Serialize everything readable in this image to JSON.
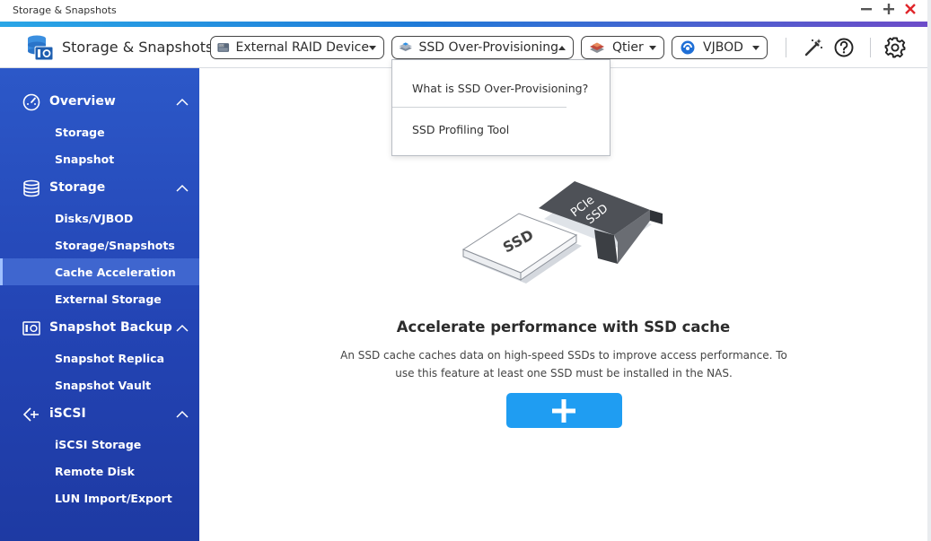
{
  "window": {
    "title": "Storage & Snapshots"
  },
  "toolbar": {
    "app_name": "Storage & Snapshots",
    "buttons": [
      {
        "label": "External RAID Device",
        "icon": "raid-device-icon"
      },
      {
        "label": "SSD Over-Provisioning",
        "icon": "ssd-stack-icon"
      },
      {
        "label": "Qtier",
        "icon": "qtier-icon"
      },
      {
        "label": "VJBOD",
        "icon": "vjbod-icon"
      }
    ],
    "icons": [
      "magic-wand-icon",
      "help-icon",
      "gear-icon"
    ]
  },
  "dropdown": {
    "items": [
      {
        "label": "What is SSD Over-Provisioning?"
      },
      {
        "label": "SSD Profiling Tool"
      }
    ]
  },
  "sidebar": {
    "sections": [
      {
        "label": "Overview",
        "icon": "gauge-icon",
        "items": [
          {
            "label": "Storage"
          },
          {
            "label": "Snapshot"
          }
        ]
      },
      {
        "label": "Storage",
        "icon": "database-icon",
        "items": [
          {
            "label": "Disks/VJBOD"
          },
          {
            "label": "Storage/Snapshots"
          },
          {
            "label": "Cache Acceleration",
            "active": true
          },
          {
            "label": "External Storage"
          }
        ]
      },
      {
        "label": "Snapshot Backup",
        "icon": "camera-backup-icon",
        "items": [
          {
            "label": "Snapshot Replica"
          },
          {
            "label": "Snapshot Vault"
          }
        ]
      },
      {
        "label": "iSCSI",
        "icon": "iscsi-icon",
        "items": [
          {
            "label": "iSCSI Storage"
          },
          {
            "label": "Remote Disk"
          },
          {
            "label": "LUN Import/Export"
          }
        ]
      }
    ]
  },
  "main": {
    "illustration": {
      "ssd_label": "SSD",
      "pcie_label_line1": "PCIe",
      "pcie_label_line2": "SSD"
    },
    "headline": "Accelerate performance with SSD cache",
    "description": "An SSD cache caches data on high-speed SSDs to improve access performance. To use this feature at least one SSD must be installed in the NAS.",
    "add_button_icon": "plus-icon"
  },
  "colors": {
    "sidebar": "#2344b4",
    "accent": "#1f9df2",
    "close": "#e0262b"
  }
}
